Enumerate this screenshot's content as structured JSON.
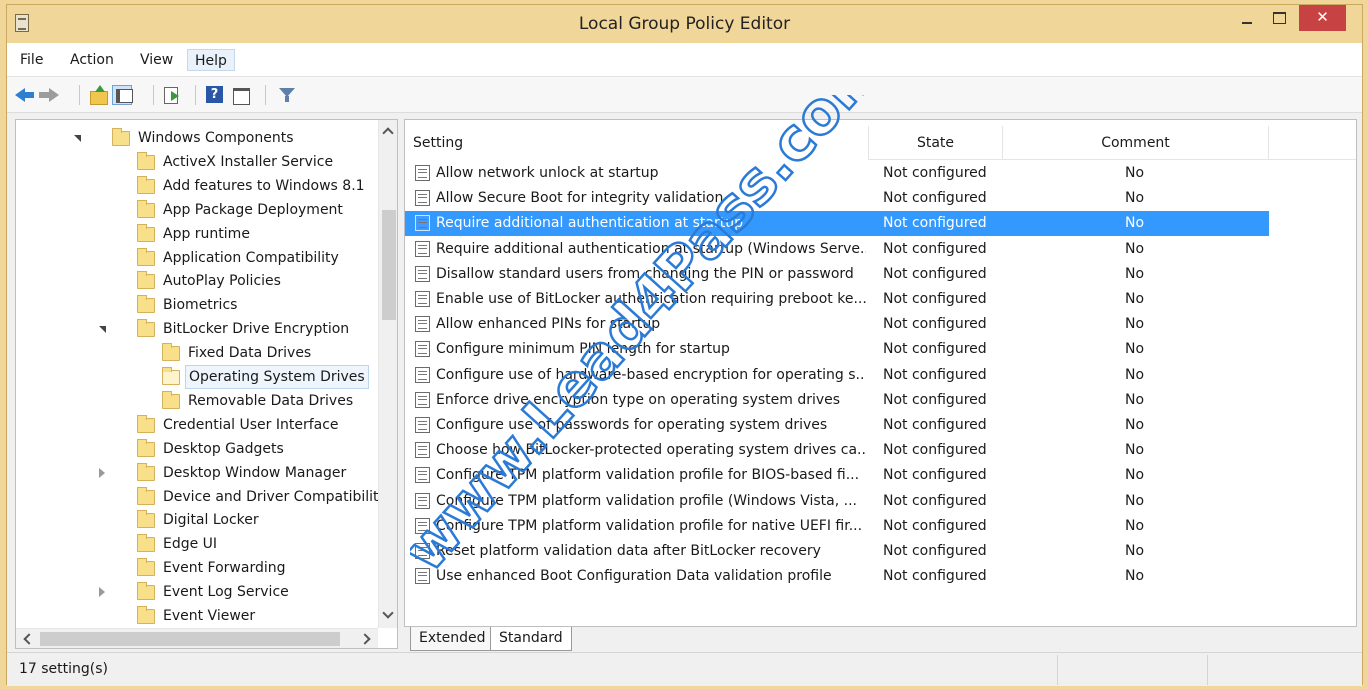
{
  "window": {
    "title": "Local Group Policy Editor",
    "close_glyph": "✕"
  },
  "menu": {
    "file": "File",
    "action": "Action",
    "view": "View",
    "help": "Help"
  },
  "tree": [
    {
      "label": "Windows Components",
      "indent": 0,
      "expander": "open"
    },
    {
      "label": "ActiveX Installer Service",
      "indent": 1
    },
    {
      "label": "Add features to Windows 8.1",
      "indent": 1
    },
    {
      "label": "App Package Deployment",
      "indent": 1
    },
    {
      "label": "App runtime",
      "indent": 1
    },
    {
      "label": "Application Compatibility",
      "indent": 1
    },
    {
      "label": "AutoPlay Policies",
      "indent": 1
    },
    {
      "label": "Biometrics",
      "indent": 1
    },
    {
      "label": "BitLocker Drive Encryption",
      "indent": 1,
      "expander": "open"
    },
    {
      "label": "Fixed Data Drives",
      "indent": 2
    },
    {
      "label": "Operating System Drives",
      "indent": 2,
      "selected": true
    },
    {
      "label": "Removable Data Drives",
      "indent": 2
    },
    {
      "label": "Credential User Interface",
      "indent": 1
    },
    {
      "label": "Desktop Gadgets",
      "indent": 1
    },
    {
      "label": "Desktop Window Manager",
      "indent": 1,
      "expander": "closed"
    },
    {
      "label": "Device and Driver Compatibilit",
      "indent": 1
    },
    {
      "label": "Digital Locker",
      "indent": 1
    },
    {
      "label": "Edge UI",
      "indent": 1
    },
    {
      "label": "Event Forwarding",
      "indent": 1
    },
    {
      "label": "Event Log Service",
      "indent": 1,
      "expander": "closed"
    },
    {
      "label": "Event Viewer",
      "indent": 1
    }
  ],
  "list": {
    "headers": {
      "setting": "Setting",
      "state": "State",
      "comment": "Comment"
    },
    "rows": [
      {
        "setting": "Allow network unlock at startup",
        "state": "Not configured",
        "comment": "No"
      },
      {
        "setting": "Allow Secure Boot for integrity validation",
        "state": "Not configured",
        "comment": "No"
      },
      {
        "setting": "Require additional authentication at startup",
        "state": "Not configured",
        "comment": "No",
        "selected": true
      },
      {
        "setting": "Require additional authentication at startup (Windows Serve...",
        "state": "Not configured",
        "comment": "No"
      },
      {
        "setting": "Disallow standard users from changing the PIN or password",
        "state": "Not configured",
        "comment": "No"
      },
      {
        "setting": "Enable use of BitLocker authentication requiring preboot ke...",
        "state": "Not configured",
        "comment": "No"
      },
      {
        "setting": "Allow enhanced PINs for startup",
        "state": "Not configured",
        "comment": "No"
      },
      {
        "setting": "Configure minimum PIN length for startup",
        "state": "Not configured",
        "comment": "No"
      },
      {
        "setting": "Configure use of hardware-based encryption for operating s...",
        "state": "Not configured",
        "comment": "No"
      },
      {
        "setting": "Enforce drive encryption type on operating system drives",
        "state": "Not configured",
        "comment": "No"
      },
      {
        "setting": "Configure use of passwords for operating system drives",
        "state": "Not configured",
        "comment": "No"
      },
      {
        "setting": "Choose how BitLocker-protected operating system drives ca...",
        "state": "Not configured",
        "comment": "No"
      },
      {
        "setting": "Configure TPM platform validation profile for BIOS-based fi...",
        "state": "Not configured",
        "comment": "No"
      },
      {
        "setting": "Configure TPM platform validation profile (Windows Vista, ...",
        "state": "Not configured",
        "comment": "No"
      },
      {
        "setting": "Configure TPM platform validation profile for native UEFI fir...",
        "state": "Not configured",
        "comment": "No"
      },
      {
        "setting": "Reset platform validation data after BitLocker recovery",
        "state": "Not configured",
        "comment": "No"
      },
      {
        "setting": "Use enhanced Boot Configuration Data validation profile",
        "state": "Not configured",
        "comment": "No"
      }
    ]
  },
  "tabs": {
    "extended": "Extended",
    "standard": "Standard"
  },
  "status": {
    "text": "17 setting(s)"
  },
  "watermark": {
    "text": "www.Lead4Pass.com"
  },
  "colors": {
    "selection": "#3399ff",
    "titlebar": "#f1d699",
    "close": "#c74343",
    "watermark": "#2b7bd6"
  }
}
